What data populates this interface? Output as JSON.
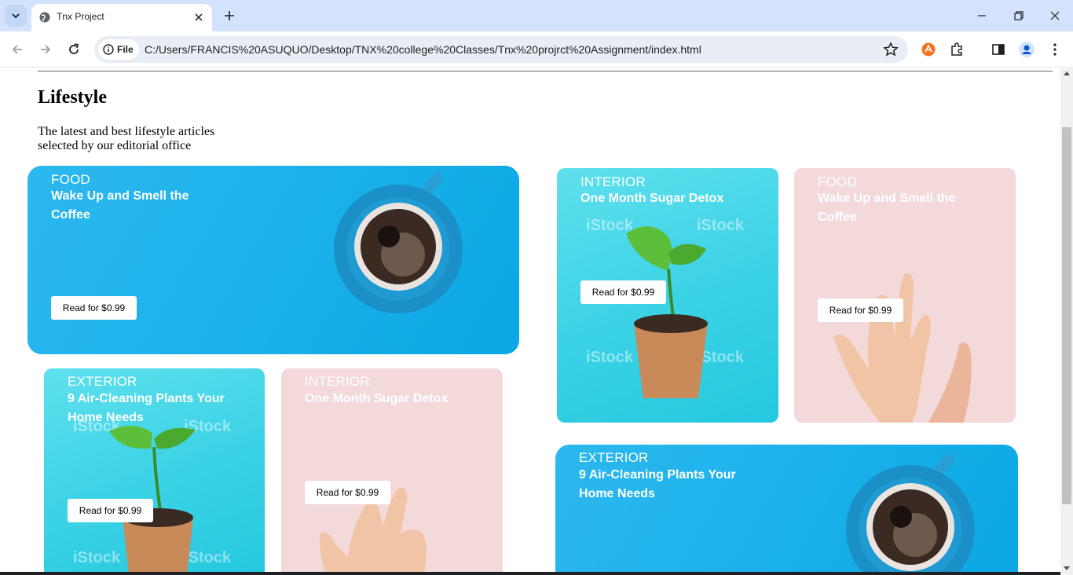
{
  "browser": {
    "tab_title": "Tnx Project",
    "site_chip": "File",
    "url": "C:/Users/FRANCIS%20ASUQUO/Desktop/TNX%20college%20Classes/Tnx%20projrct%20Assignment/index.html"
  },
  "page": {
    "heading": "Lifestyle",
    "subtitle": "The latest and best lifestyle articles selected by our editorial office"
  },
  "cards": [
    {
      "category": "FOOD",
      "title": "Wake Up and Smell the Coffee",
      "button": "Read for $0.99"
    },
    {
      "category": "INTERIOR",
      "title": "One Month Sugar Detox",
      "button": "Read for $0.99",
      "watermark": "iStock"
    },
    {
      "category": "FOOD",
      "title": "Wake Up and Smell the Coffee",
      "button": "Read for $0.99"
    },
    {
      "category": "EXTERIOR",
      "title": "9 Air-Cleaning Plants Your Home Needs",
      "button": "Read for $0.99",
      "watermark": "iStock"
    },
    {
      "category": "INTERIOR",
      "title": "One Month Sugar Detox",
      "button": "Read for $0.99"
    },
    {
      "category": "EXTERIOR",
      "title": "9 Air-Cleaning Plants Your Home Needs"
    }
  ],
  "colors": {
    "tabbar": "#d3e3fd",
    "card_blue": "#1ab0ea",
    "card_teal": "#3dd3e6",
    "card_pink": "#f3d9da"
  }
}
